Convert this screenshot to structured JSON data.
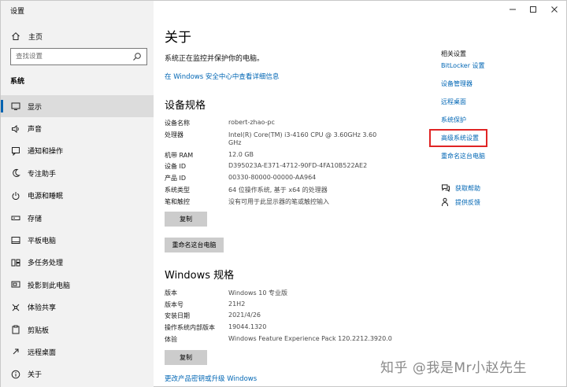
{
  "window": {
    "title": "设置",
    "controls": [
      "minimize",
      "maximize",
      "close"
    ]
  },
  "sidebar": {
    "home_label": "主页",
    "search_placeholder": "查找设置",
    "section": "系统",
    "items": [
      {
        "label": "显示",
        "icon": "monitor-icon",
        "selected": true
      },
      {
        "label": "声音",
        "icon": "speaker-icon"
      },
      {
        "label": "通知和操作",
        "icon": "notification-icon"
      },
      {
        "label": "专注助手",
        "icon": "moon-icon"
      },
      {
        "label": "电源和睡眠",
        "icon": "power-icon"
      },
      {
        "label": "存储",
        "icon": "storage-icon"
      },
      {
        "label": "平板电脑",
        "icon": "tablet-icon"
      },
      {
        "label": "多任务处理",
        "icon": "multitask-icon"
      },
      {
        "label": "投影到此电脑",
        "icon": "project-icon"
      },
      {
        "label": "体验共享",
        "icon": "share-icon"
      },
      {
        "label": "剪贴板",
        "icon": "clipboard-icon"
      },
      {
        "label": "远程桌面",
        "icon": "remote-icon"
      },
      {
        "label": "关于",
        "icon": "info-icon"
      }
    ]
  },
  "main": {
    "title": "关于",
    "protection_text": "系统正在监控并保护你的电脑。",
    "security_link": "在 Windows 安全中心中查看详细信息",
    "device_spec_heading": "设备规格",
    "device_specs": [
      {
        "label": "设备名称",
        "value": "robert-zhao-pc"
      },
      {
        "label": "处理器",
        "value": "Intel(R) Core(TM) i3-4160 CPU @ 3.60GHz   3.60",
        "value2": "GHz"
      },
      {
        "label": "机带 RAM",
        "value": "12.0 GB"
      },
      {
        "label": "设备 ID",
        "value": "D395023A-E371-4712-90FD-4FA10B522AE2"
      },
      {
        "label": "产品 ID",
        "value": "00330-80000-00000-AA964"
      },
      {
        "label": "系统类型",
        "value": "64 位操作系统, 基于 x64 的处理器"
      },
      {
        "label": "笔和触控",
        "value": "没有可用于此显示器的笔或触控输入"
      }
    ],
    "copy_button": "复制",
    "rename_button": "重命名这台电脑",
    "windows_spec_heading": "Windows 规格",
    "windows_specs": [
      {
        "label": "版本",
        "value": "Windows 10 专业版"
      },
      {
        "label": "版本号",
        "value": "21H2"
      },
      {
        "label": "安装日期",
        "value": "2021/4/26"
      },
      {
        "label": "操作系统内部版本",
        "value": "19044.1320"
      },
      {
        "label": "体验",
        "value": "Windows Feature Experience Pack 120.2212.3920.0"
      }
    ],
    "copy_button2": "复制",
    "bottom_link": "更改产品密钥或升级 Windows"
  },
  "related": {
    "heading": "相关设置",
    "links": [
      "BitLocker 设置",
      "设备管理器",
      "远程桌面",
      "系统保护",
      "高级系统设置",
      "重命名这台电脑"
    ],
    "highlighted": "高级系统设置",
    "highlight_color": "#e02424",
    "help": "获取帮助",
    "feedback": "提供反馈"
  },
  "watermark": "知乎 @我是Mr小赵先生",
  "colors": {
    "accent": "#0063b1",
    "link": "#0066b4",
    "sidebar_bg": "#f2f2f2",
    "button_bg": "#cccccc"
  }
}
